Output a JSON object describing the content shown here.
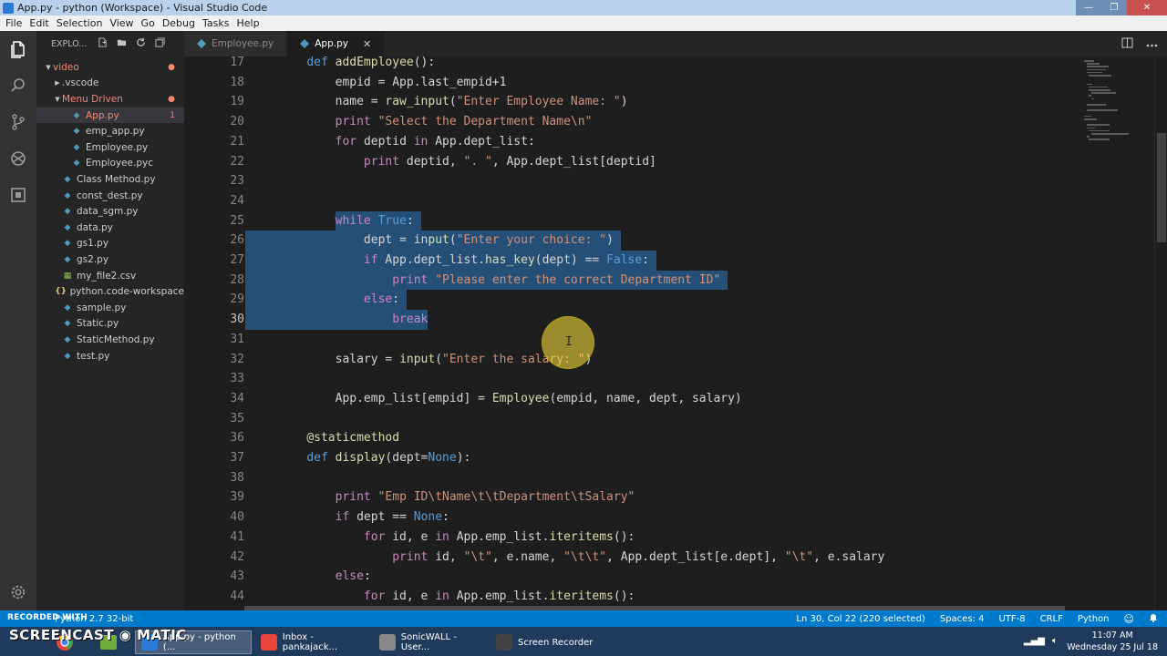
{
  "window": {
    "title": "App.py - python (Workspace) - Visual Studio Code",
    "min": "—",
    "max": "❐",
    "close": "✕"
  },
  "menu": [
    "File",
    "Edit",
    "Selection",
    "View",
    "Go",
    "Debug",
    "Tasks",
    "Help"
  ],
  "sidebar": {
    "header": "EXPLO...",
    "tree": [
      {
        "label": "video",
        "indent": 0,
        "arrow": "▼",
        "mod": true,
        "badge": "●"
      },
      {
        "label": ".vscode",
        "indent": 1,
        "arrow": "▶",
        "mod": false
      },
      {
        "label": "Menu Driven",
        "indent": 1,
        "arrow": "▼",
        "mod": true,
        "badge": "●"
      },
      {
        "label": "App.py",
        "indent": 2,
        "icon": "py",
        "mod": true,
        "badge": "1",
        "selected": true
      },
      {
        "label": "emp_app.py",
        "indent": 2,
        "icon": "py"
      },
      {
        "label": "Employee.py",
        "indent": 2,
        "icon": "py"
      },
      {
        "label": "Employee.pyc",
        "indent": 2,
        "icon": "pyc"
      },
      {
        "label": "Class Method.py",
        "indent": 1,
        "icon": "py"
      },
      {
        "label": "const_dest.py",
        "indent": 1,
        "icon": "py"
      },
      {
        "label": "data_sgm.py",
        "indent": 1,
        "icon": "py"
      },
      {
        "label": "data.py",
        "indent": 1,
        "icon": "py"
      },
      {
        "label": "gs1.py",
        "indent": 1,
        "icon": "py"
      },
      {
        "label": "gs2.py",
        "indent": 1,
        "icon": "py"
      },
      {
        "label": "my_file2.csv",
        "indent": 1,
        "icon": "csv"
      },
      {
        "label": "python.code-workspace",
        "indent": 1,
        "icon": "ws"
      },
      {
        "label": "sample.py",
        "indent": 1,
        "icon": "py"
      },
      {
        "label": "Static.py",
        "indent": 1,
        "icon": "py"
      },
      {
        "label": "StaticMethod.py",
        "indent": 1,
        "icon": "py"
      },
      {
        "label": "test.py",
        "indent": 1,
        "icon": "py"
      }
    ]
  },
  "tabs": [
    {
      "label": "Employee.py",
      "active": false
    },
    {
      "label": "App.py",
      "active": true,
      "close": "✕"
    }
  ],
  "editor": {
    "current_line": 30,
    "lines": [
      {
        "n": 17,
        "segs": [
          [
            "    ",
            ""
          ],
          [
            "def ",
            "kw"
          ],
          [
            "addEmployee",
            "fn"
          ],
          [
            "():",
            ""
          ]
        ]
      },
      {
        "n": 18,
        "segs": [
          [
            "        empid = App.last_empid+1",
            ""
          ]
        ]
      },
      {
        "n": 19,
        "segs": [
          [
            "        name = ",
            ""
          ],
          [
            "raw_input",
            "fn"
          ],
          [
            "(",
            ""
          ],
          [
            "\"Enter Employee Name: \"",
            "str"
          ],
          [
            ")",
            ""
          ]
        ]
      },
      {
        "n": 20,
        "segs": [
          [
            "        ",
            ""
          ],
          [
            "print ",
            "ctrl"
          ],
          [
            "\"Select the Department Name\\n\"",
            "str"
          ]
        ]
      },
      {
        "n": 21,
        "segs": [
          [
            "        ",
            ""
          ],
          [
            "for ",
            "ctrl"
          ],
          [
            "deptid ",
            ""
          ],
          [
            "in ",
            "ctrl"
          ],
          [
            "App.dept_list:",
            ""
          ]
        ]
      },
      {
        "n": 22,
        "segs": [
          [
            "            ",
            ""
          ],
          [
            "print ",
            "ctrl"
          ],
          [
            "deptid, ",
            ""
          ],
          [
            "\". \"",
            "str"
          ],
          [
            ", App.dept_list[deptid]",
            ""
          ]
        ]
      },
      {
        "n": 23,
        "segs": [
          [
            "",
            ""
          ]
        ]
      },
      {
        "n": 24,
        "segs": [
          [
            "",
            ""
          ]
        ]
      },
      {
        "n": 25,
        "segs": [
          [
            "        ",
            ""
          ],
          [
            "while ",
            "ctrl"
          ],
          [
            "True",
            "kw"
          ],
          [
            ":",
            ""
          ]
        ]
      },
      {
        "n": 26,
        "segs": [
          [
            "            dept = ",
            ""
          ],
          [
            "input",
            "fn"
          ],
          [
            "(",
            ""
          ],
          [
            "\"Enter your choice: \"",
            "str"
          ],
          [
            ")",
            ""
          ]
        ]
      },
      {
        "n": 27,
        "segs": [
          [
            "            ",
            ""
          ],
          [
            "if ",
            "ctrl"
          ],
          [
            "App.dept_list.",
            ""
          ],
          [
            "has_key",
            "fn"
          ],
          [
            "(dept) == ",
            ""
          ],
          [
            "False",
            "kw"
          ],
          [
            ":",
            ""
          ]
        ]
      },
      {
        "n": 28,
        "segs": [
          [
            "                ",
            ""
          ],
          [
            "print ",
            "ctrl"
          ],
          [
            "\"Please enter the correct Department ID\"",
            "str"
          ]
        ]
      },
      {
        "n": 29,
        "segs": [
          [
            "            ",
            ""
          ],
          [
            "else",
            "ctrl"
          ],
          [
            ":",
            ""
          ]
        ]
      },
      {
        "n": 30,
        "segs": [
          [
            "                ",
            ""
          ],
          [
            "break",
            "ctrl"
          ]
        ]
      },
      {
        "n": 31,
        "segs": [
          [
            "",
            ""
          ]
        ]
      },
      {
        "n": 32,
        "segs": [
          [
            "        salary = ",
            ""
          ],
          [
            "input",
            "fn"
          ],
          [
            "(",
            ""
          ],
          [
            "\"Enter the salary: \"",
            "str"
          ],
          [
            ")",
            ""
          ]
        ]
      },
      {
        "n": 33,
        "segs": [
          [
            "",
            ""
          ]
        ]
      },
      {
        "n": 34,
        "segs": [
          [
            "        App.emp_list[empid] = ",
            ""
          ],
          [
            "Employee",
            "fn"
          ],
          [
            "(empid, name, dept, salary)",
            ""
          ]
        ]
      },
      {
        "n": 35,
        "segs": [
          [
            "",
            ""
          ]
        ]
      },
      {
        "n": 36,
        "segs": [
          [
            "    ",
            ""
          ],
          [
            "@staticmethod",
            "deco"
          ]
        ]
      },
      {
        "n": 37,
        "segs": [
          [
            "    ",
            ""
          ],
          [
            "def ",
            "kw"
          ],
          [
            "display",
            "fn"
          ],
          [
            "(dept=",
            ""
          ],
          [
            "None",
            "kw"
          ],
          [
            "):",
            ""
          ]
        ]
      },
      {
        "n": 38,
        "segs": [
          [
            "",
            ""
          ]
        ]
      },
      {
        "n": 39,
        "segs": [
          [
            "        ",
            ""
          ],
          [
            "print ",
            "ctrl"
          ],
          [
            "\"Emp ID\\tName\\t\\tDepartment\\tSalary\"",
            "str"
          ]
        ]
      },
      {
        "n": 40,
        "segs": [
          [
            "        ",
            ""
          ],
          [
            "if ",
            "ctrl"
          ],
          [
            "dept == ",
            ""
          ],
          [
            "None",
            "kw"
          ],
          [
            ":",
            ""
          ]
        ]
      },
      {
        "n": 41,
        "segs": [
          [
            "            ",
            ""
          ],
          [
            "for ",
            "ctrl"
          ],
          [
            "id, e ",
            ""
          ],
          [
            "in ",
            "ctrl"
          ],
          [
            "App.emp_list.",
            ""
          ],
          [
            "iteritems",
            "fn"
          ],
          [
            "():",
            ""
          ]
        ]
      },
      {
        "n": 42,
        "segs": [
          [
            "                ",
            ""
          ],
          [
            "print ",
            "ctrl"
          ],
          [
            "id, ",
            ""
          ],
          [
            "\"\\t\"",
            "str"
          ],
          [
            ", e.name, ",
            ""
          ],
          [
            "\"\\t\\t\"",
            "str"
          ],
          [
            ", App.dept_list[e.dept], ",
            ""
          ],
          [
            "\"\\t\"",
            "str"
          ],
          [
            ", e.salary",
            ""
          ]
        ]
      },
      {
        "n": 43,
        "segs": [
          [
            "        ",
            ""
          ],
          [
            "else",
            "ctrl"
          ],
          [
            ":",
            ""
          ]
        ]
      },
      {
        "n": 44,
        "segs": [
          [
            "            ",
            ""
          ],
          [
            "for ",
            "ctrl"
          ],
          [
            "id, e ",
            ""
          ],
          [
            "in ",
            "ctrl"
          ],
          [
            "App.emp_list.",
            ""
          ],
          [
            "iteritems",
            "fn"
          ],
          [
            "():",
            ""
          ]
        ]
      }
    ]
  },
  "status": {
    "left": "Python 2.7 32-bit",
    "position": "Ln 30, Col 22 (220 selected)",
    "spaces": "Spaces: 4",
    "encoding": "UTF-8",
    "eol": "CRLF",
    "language": "Python"
  },
  "overlay": {
    "recorded": "RECORDED WITH",
    "logo": "SCREENCAST ◉ MATIC"
  },
  "taskbar": {
    "items": [
      {
        "label": "App.py - python (...",
        "color": "#2b7bd6",
        "active": true
      },
      {
        "label": "Inbox - pankajack...",
        "color": "#e8453c",
        "active": false
      },
      {
        "label": "SonicWALL - User...",
        "color": "#888888",
        "active": false
      },
      {
        "label": "Screen Recorder",
        "color": "#444444",
        "active": false
      }
    ],
    "time": "11:07 AM",
    "date": "Wednesday 25 Jul 18"
  }
}
